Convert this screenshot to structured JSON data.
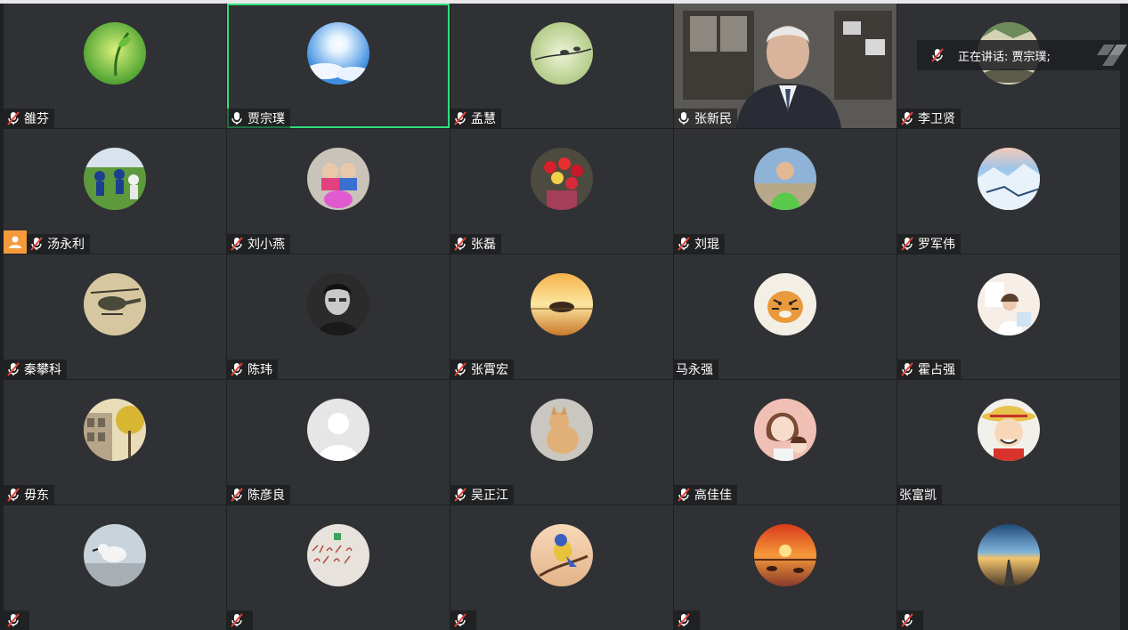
{
  "speaking_indicator": {
    "text": "正在讲话: 贾宗璞;"
  },
  "colors": {
    "active_border": "#2ee07a",
    "host_badge": "#f59a3a",
    "mic_muted_red": "#e0413a",
    "tile_bg": "#303134"
  },
  "participants": [
    {
      "name": "雒芬",
      "mic": "muted",
      "avatar": "green-leaf-avatar"
    },
    {
      "name": "贾宗璞",
      "mic": "on",
      "avatar": "blue-sky-sun-avatar",
      "active": true
    },
    {
      "name": "孟慧",
      "mic": "muted",
      "avatar": "green-branch-avatar"
    },
    {
      "name": "张新民",
      "mic": "on",
      "avatar": "camera-video"
    },
    {
      "name": "李卫贤",
      "mic": "muted",
      "avatar": "landscape-avatar"
    },
    {
      "name": "汤永利",
      "mic": "muted",
      "avatar": "soccer-players-avatar",
      "host": true
    },
    {
      "name": "刘小燕",
      "mic": "muted",
      "avatar": "two-children-avatar"
    },
    {
      "name": "张磊",
      "mic": "muted",
      "avatar": "roses-bouquet-avatar"
    },
    {
      "name": "刘琨",
      "mic": "muted",
      "avatar": "boy-green-shirt-avatar"
    },
    {
      "name": "罗军伟",
      "mic": "muted",
      "avatar": "snow-mountain-avatar"
    },
    {
      "name": "秦攀科",
      "mic": "muted",
      "avatar": "helicopter-avatar"
    },
    {
      "name": "陈玮",
      "mic": "muted",
      "avatar": "man-bw-portrait-avatar"
    },
    {
      "name": "张霄宏",
      "mic": "muted",
      "avatar": "sunset-island-avatar"
    },
    {
      "name": "马永强",
      "mic": "none",
      "avatar": "tiger-painting-avatar"
    },
    {
      "name": "霍占强",
      "mic": "muted",
      "avatar": "girl-white-room-avatar"
    },
    {
      "name": "毋东",
      "mic": "muted",
      "avatar": "autumn-street-avatar"
    },
    {
      "name": "陈彦良",
      "mic": "muted",
      "avatar": "default-user-avatar"
    },
    {
      "name": "吴正江",
      "mic": "muted",
      "avatar": "cat-avatar"
    },
    {
      "name": "高佳佳",
      "mic": "muted",
      "avatar": "cartoon-mother-child-avatar"
    },
    {
      "name": "张富凯",
      "mic": "none",
      "avatar": "cartoon-luffy-avatar"
    },
    {
      "name": "",
      "mic": "muted",
      "avatar": "seabird-avatar"
    },
    {
      "name": "",
      "mic": "muted",
      "avatar": "handwritten-numbers-avatar"
    },
    {
      "name": "",
      "mic": "muted",
      "avatar": "bird-on-branch-avatar"
    },
    {
      "name": "",
      "mic": "muted",
      "avatar": "red-sunset-avatar"
    },
    {
      "name": "",
      "mic": "muted",
      "avatar": "road-sunset-avatar"
    }
  ]
}
